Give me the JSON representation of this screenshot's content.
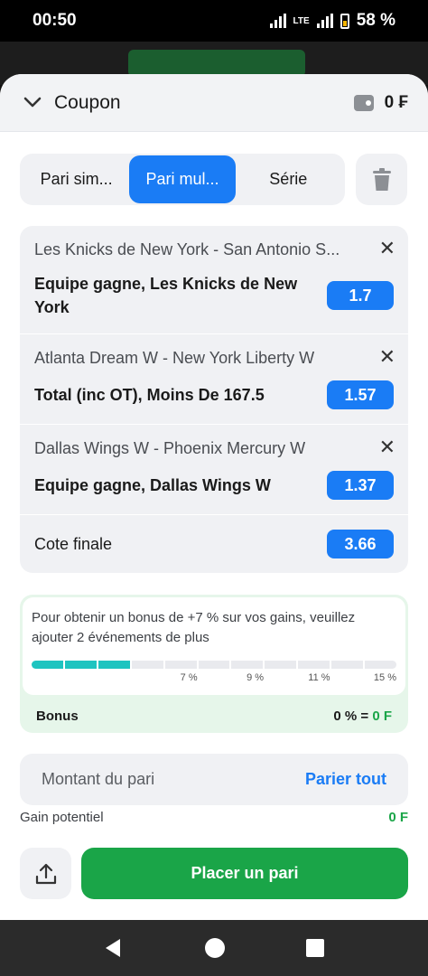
{
  "status_bar": {
    "time": "00:50",
    "network": "LTE",
    "battery": "58 %"
  },
  "header": {
    "title": "Coupon",
    "balance": "0 ₣"
  },
  "tabs": [
    {
      "label": "Pari sim...",
      "active": false
    },
    {
      "label": "Pari mul...",
      "active": true
    },
    {
      "label": "Série",
      "active": false
    }
  ],
  "bets": [
    {
      "match": "Les Knicks de New York - San Antonio S...",
      "selection": "Equipe gagne, Les Knicks de New York",
      "odd": "1.7"
    },
    {
      "match": "Atlanta Dream W - New York Liberty W",
      "selection": "Total (inc OT), Moins De 167.5",
      "odd": "1.57"
    },
    {
      "match": "Dallas Wings W - Phoenix Mercury W",
      "selection": "Equipe gagne, Dallas Wings W",
      "odd": "1.37"
    }
  ],
  "final": {
    "label": "Cote finale",
    "odd": "3.66"
  },
  "bonus": {
    "message": "Pour obtenir un bonus de +7 % sur vos gains, veuillez ajouter 2 événements de plus",
    "progress_filled": 3,
    "progress_total": 11,
    "marks": [
      "7 %",
      "9 %",
      "11 %",
      "15 %"
    ],
    "label": "Bonus",
    "percent": "0 % =",
    "amount": "0 F"
  },
  "amount": {
    "placeholder": "Montant du pari",
    "all_label": "Parier tout"
  },
  "gain": {
    "label": "Gain potentiel",
    "value": "0 F"
  },
  "place_bet_label": "Placer un pari",
  "colors": {
    "primary": "#1a7cf5",
    "success": "#1aa548",
    "progress": "#1ec4c0"
  }
}
